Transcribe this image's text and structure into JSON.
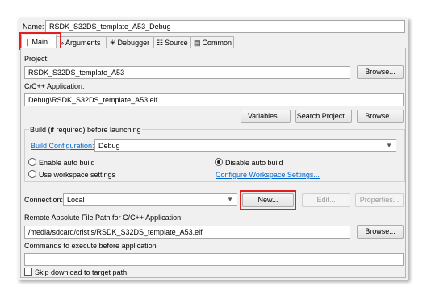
{
  "name": {
    "label": "Name:",
    "value": "RSDK_S32DS_template_A53_Debug"
  },
  "tabs": [
    {
      "label": "Main",
      "icon": "main-page-icon",
      "glyph": "❙"
    },
    {
      "label": "Arguments",
      "icon": "arguments-icon",
      "glyph": "»"
    },
    {
      "label": "Debugger",
      "icon": "debugger-icon",
      "glyph": "✳"
    },
    {
      "label": "Source",
      "icon": "source-icon",
      "glyph": "☷"
    },
    {
      "label": "Common",
      "icon": "common-icon",
      "glyph": "▤"
    }
  ],
  "project": {
    "label": "Project:",
    "value": "RSDK_S32DS_template_A53",
    "browse": "Browse..."
  },
  "application": {
    "label": "C/C++ Application:",
    "value": "Debug\\RSDK_S32DS_template_A53.elf",
    "variables": "Variables...",
    "search": "Search Project...",
    "browse": "Browse..."
  },
  "build": {
    "group_label": "Build (if required) before launching",
    "config_link": "Build Configuration:",
    "config_value": "Debug",
    "enable_auto": "Enable auto build",
    "disable_auto": "Disable auto build",
    "use_workspace": "Use workspace settings",
    "configure_link": "Configure Workspace Settings..."
  },
  "connection": {
    "label": "Connection:",
    "value": "Local",
    "new": "New...",
    "edit": "Edit...",
    "properties": "Properties..."
  },
  "remote": {
    "label": "Remote Absolute File Path for C/C++ Application:",
    "value": "/media/sdcard/cristis/RSDK_S32DS_template_A53.elf",
    "browse": "Browse..."
  },
  "commands": {
    "label": "Commands to execute before application",
    "value": ""
  },
  "skip_download": {
    "label": "Skip download to target path.",
    "checked": false
  },
  "colors": {
    "highlight": "#e02020",
    "link": "#0066cc"
  }
}
